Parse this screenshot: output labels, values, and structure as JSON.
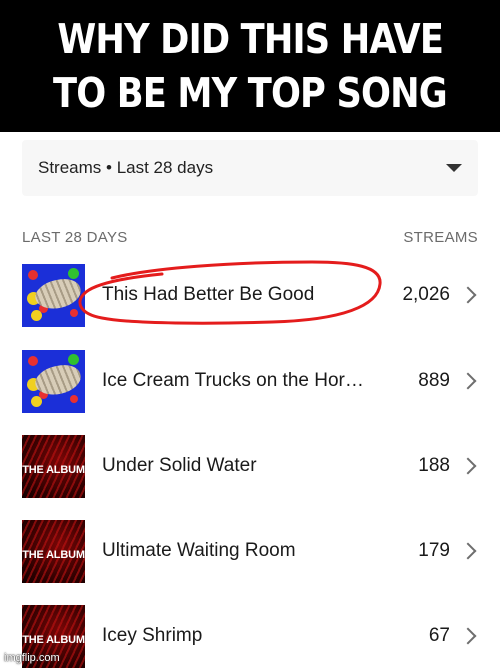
{
  "meme": {
    "caption_line1": "WHY DID THIS HAVE",
    "caption_line2": "TO BE MY TOP SONG",
    "watermark": "imgflip.com"
  },
  "filter": {
    "label": "Streams • Last 28 days"
  },
  "list": {
    "period_header": "LAST 28 DAYS",
    "streams_header": "STREAMS",
    "songs": [
      {
        "title": "This Had Better Be Good",
        "streams": "2,026",
        "art": "grub-blue-art"
      },
      {
        "title": "Ice Cream Trucks on the Hor…",
        "streams": "889",
        "art": "grub-blue-art"
      },
      {
        "title": "Under Solid Water",
        "streams": "188",
        "art": "red-album-art",
        "art_text": "THE ALBUM"
      },
      {
        "title": "Ultimate Waiting Room",
        "streams": "179",
        "art": "red-album-art",
        "art_text": "THE ALBUM"
      },
      {
        "title": "Icey Shrimp",
        "streams": "67",
        "art": "red-album-art",
        "art_text": "THE ALBUM"
      }
    ]
  },
  "colors": {
    "highlight_circle": "#e41c1c",
    "caption_bg": "#000000"
  }
}
